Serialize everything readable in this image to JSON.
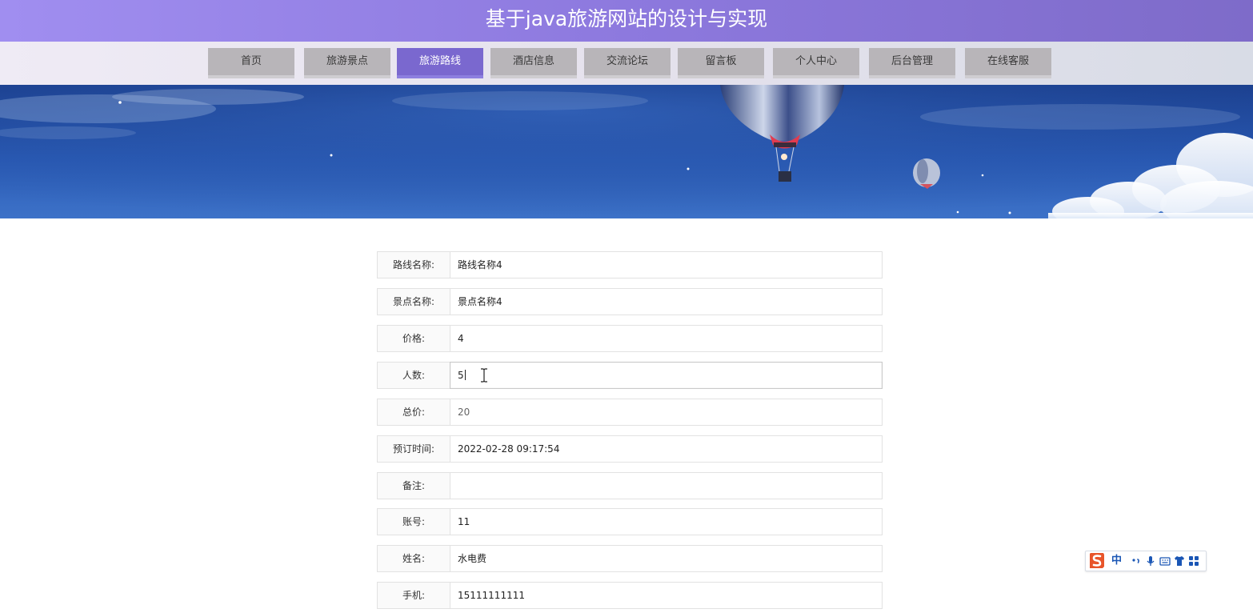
{
  "header": {
    "title": "基于java旅游网站的设计与实现"
  },
  "nav": {
    "items": [
      {
        "label": "首页"
      },
      {
        "label": "旅游景点"
      },
      {
        "label": "旅游路线"
      },
      {
        "label": "酒店信息"
      },
      {
        "label": "交流论坛"
      },
      {
        "label": "留言板"
      },
      {
        "label": "个人中心"
      },
      {
        "label": "后台管理"
      },
      {
        "label": "在线客服"
      }
    ],
    "active_label": "旅游路线"
  },
  "form": {
    "fields": [
      {
        "label": "路线名称:",
        "value": "路线名称4"
      },
      {
        "label": "景点名称:",
        "value": "景点名称4"
      },
      {
        "label": "价格:",
        "value": "4"
      },
      {
        "label": "人数:",
        "value": "5"
      },
      {
        "label": "总价:",
        "value": "20"
      },
      {
        "label": "预订时间:",
        "value": "2022-02-28 09:17:54"
      },
      {
        "label": "备注:",
        "value": ""
      },
      {
        "label": "账号:",
        "value": "11"
      },
      {
        "label": "姓名:",
        "value": "水电费"
      },
      {
        "label": "手机:",
        "value": "15111111111"
      }
    ]
  },
  "ime": {
    "mode_label": "中"
  },
  "colors": {
    "header_start": "#a08ef0",
    "header_end": "#7e6bc9",
    "nav_active": "#7a68cf",
    "nav_inactive": "#b8b5b9",
    "ime_logo": "#e8552a",
    "ime_blue": "#1a56b5"
  }
}
